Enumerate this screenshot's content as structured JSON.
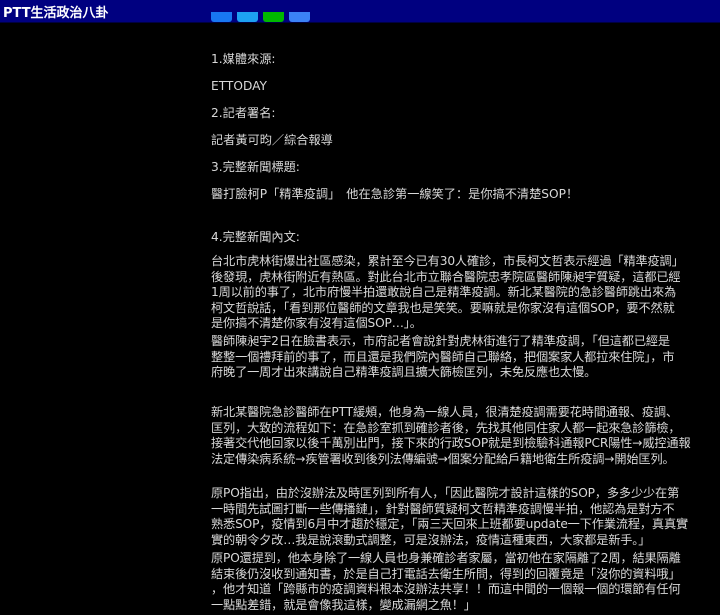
{
  "board": {
    "title": "PTT生活政治八卦"
  },
  "share_buttons": [
    "#1877f2",
    "#1da1f2",
    "#00b900",
    "#3b82f6"
  ],
  "article": {
    "sec1_heading": "1.媒體來源:",
    "sec1_value": "ETTODAY",
    "sec2_heading": "2.記者署名:",
    "sec2_value": "記者黃可昀／綜合報導",
    "sec3_heading": "3.完整新聞標題:",
    "sec3_value": "醫打臉柯P「精準疫調」　他在急診第一線笑了：是你搞不清楚SOP！",
    "sec4_heading": "4.完整新聞內文:",
    "paragraphs": [
      {
        "lines": [
          "台北市虎林街爆出社區感染，累計至今已有30人確診，市長柯文哲表示經過「精準疫調」",
          "後發現，虎林街附近有熱區。對此台北市立聯合醫院忠孝院區醫師陳昶宇質疑，這都已經",
          "1周以前的事了，北市府慢半拍還敢說自己是精準疫調。新北某醫院的急診醫師跳出來為",
          "柯文哲說話，「看到那位醫師的文章我也是笑笑。要嘛就是你家沒有這個SOP，要不然就",
          "是你搞不清楚你家有沒有這個SOP…」。"
        ]
      },
      {
        "lines": [
          "醫師陳昶宇2日在臉書表示，市府記者會說針對虎林街進行了精準疫調，「但這都已經是",
          "整整一個禮拜前的事了，而且還是我們院內醫師自己聯絡，把個案家人都拉來住院」，市",
          "府晚了一周才出來講說自己精準疫調且擴大篩檢匡列，未免反應也太慢。"
        ]
      },
      {
        "lines": [
          "新北某醫院急診醫師在PTT緩頰，他身為一線人員，很清楚疫調需要花時間通報、疫調、",
          "匡列，大致的流程如下：在急診室抓到確診者後，先找其他同住家人都一起來急診篩檢，",
          "接著交代他回家以後千萬別出門，接下來的行政SOP就是到檢驗科通報PCR陽性→威控通報",
          "法定傳染病系統→疾管署收到後列法傳編號→個案分配給戶籍地衛生所疫調→開始匡列。"
        ]
      },
      {
        "lines": [
          "原PO指出，由於沒辦法及時匡列到所有人，「因此醫院才設計這樣的SOP，多多少少在第",
          "一時間先試圖打斷一些傳播鏈」，針對醫師質疑柯文哲精準疫調慢半拍，他認為是對方不",
          "熟悉SOP，疫情到6月中才趨於穩定，「兩三天回來上班都要update一下作業流程，真真實",
          "實的朝令夕改…我是說滾動式調整，可是沒辦法，疫情這種東西，大家都是新手。」"
        ]
      },
      {
        "lines": [
          "原PO還提到，他本身除了一線人員也身兼確診者家屬，當初他在家隔離了2周，結果隔離",
          "結束後仍沒收到通知書，於是自己打電話去衛生所問，得到的回覆竟是「沒你的資料哦」",
          "，他才知道「跨縣市的疫調資料根本沒辦法共享！！而這中間的一個報一個的環節有任何",
          "一點點差錯，就是會像我這樣，變成漏網之魚！」"
        ]
      }
    ]
  }
}
